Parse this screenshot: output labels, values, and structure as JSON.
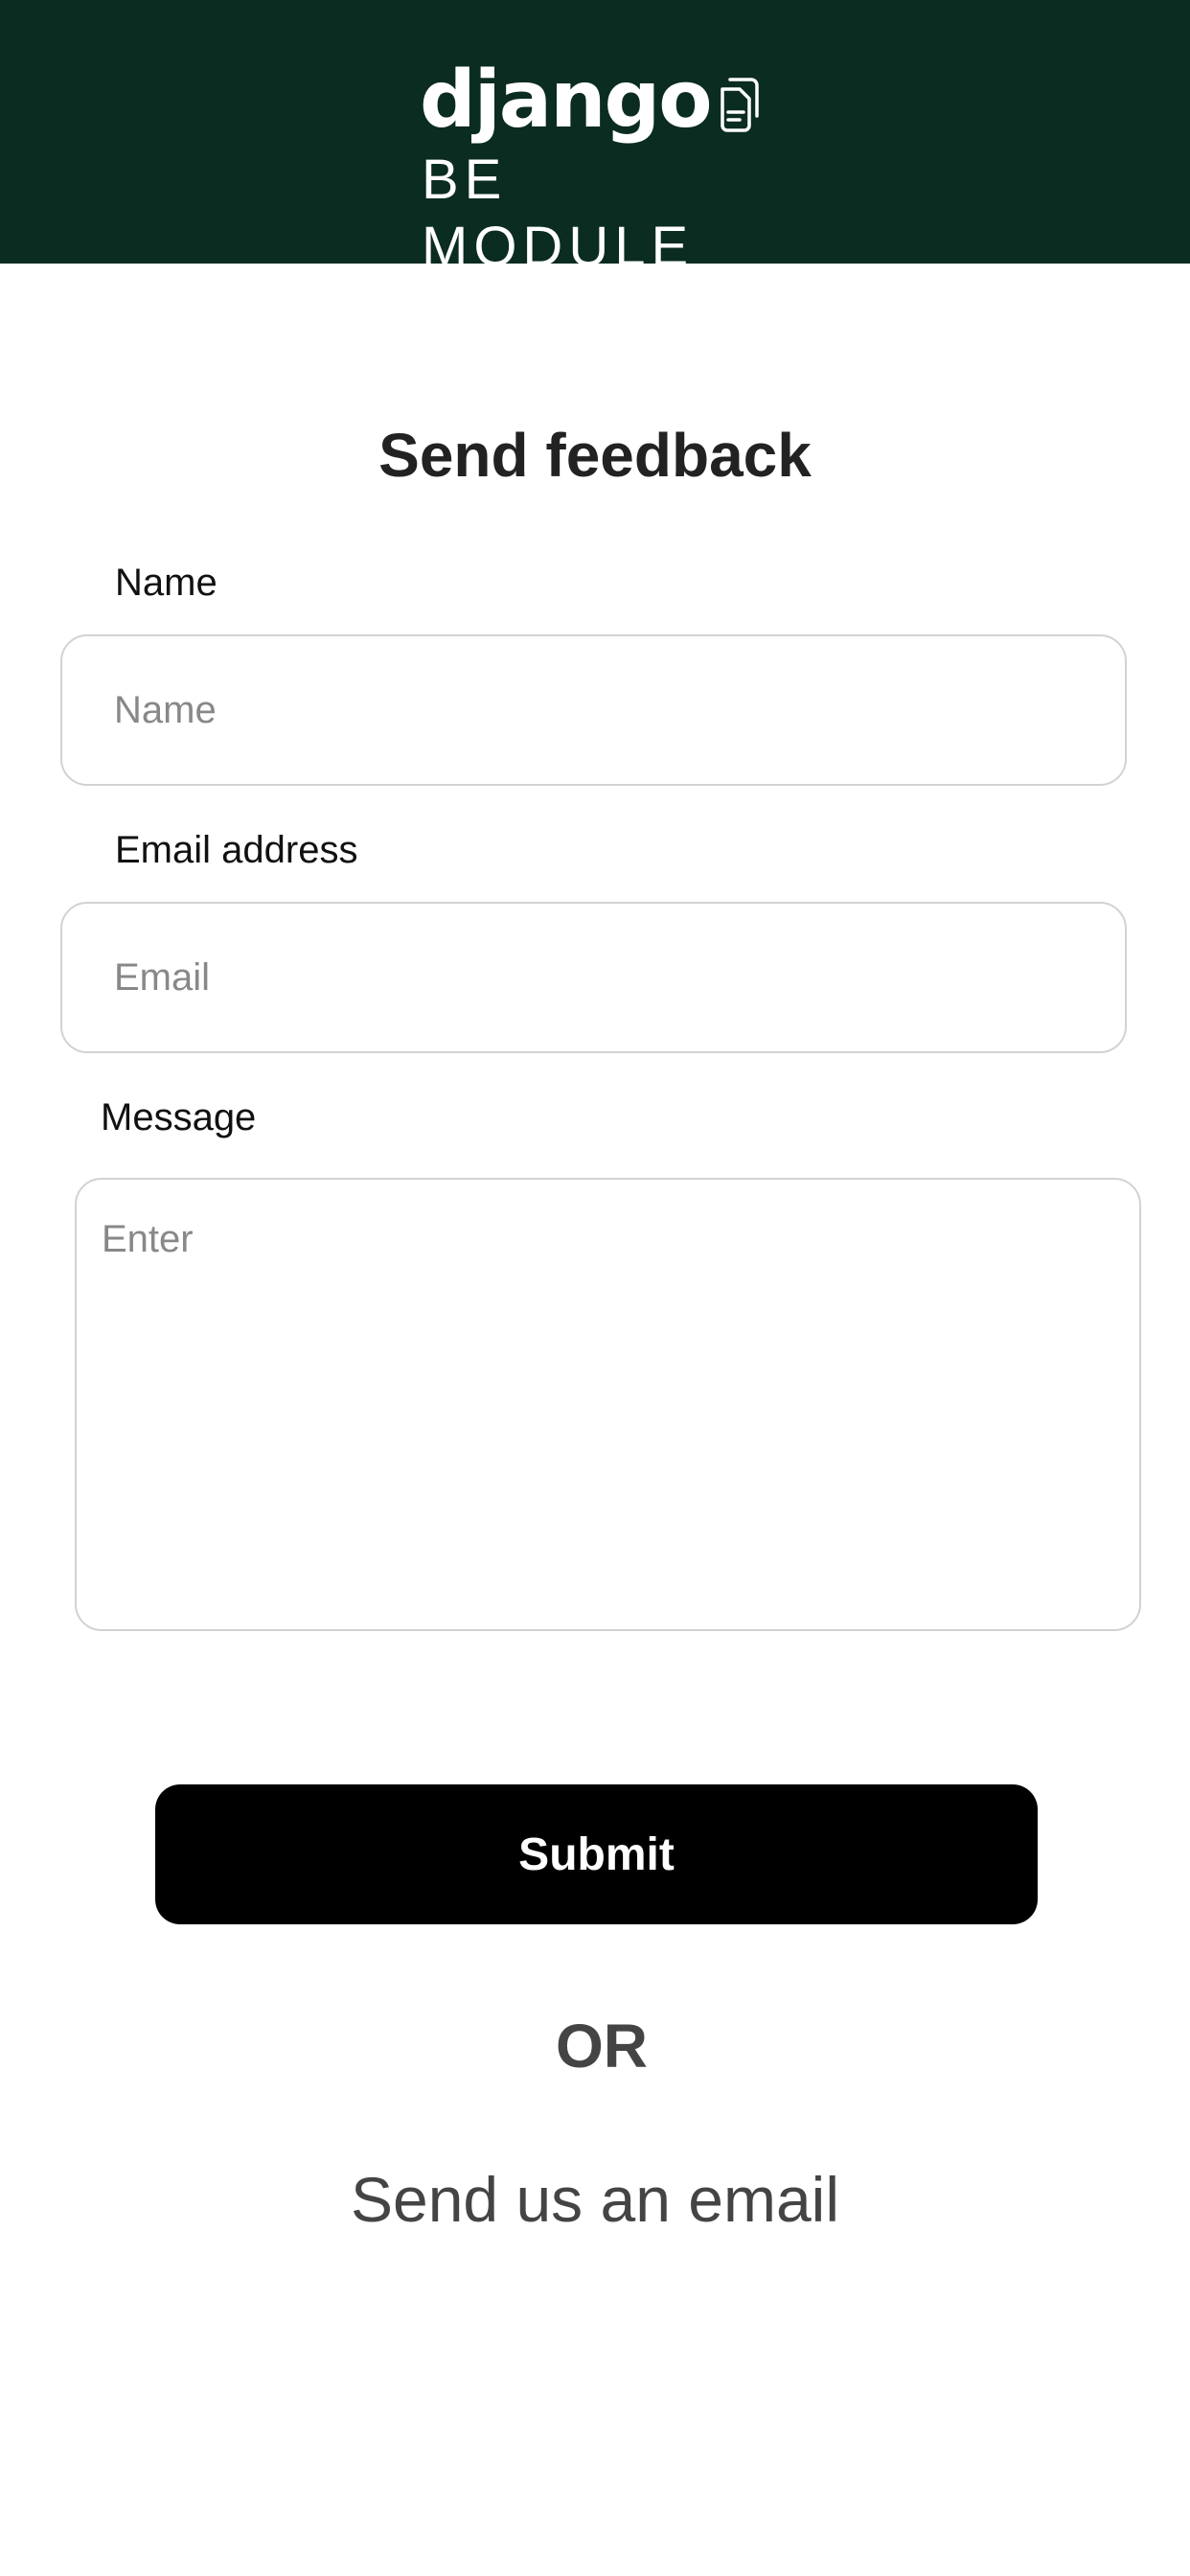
{
  "header": {
    "logo_word": "django",
    "logo_sub": "BE MODULE",
    "logo_icon": "document-icon",
    "background_color": "#0b2c20"
  },
  "page": {
    "title": "Send feedback"
  },
  "form": {
    "name": {
      "label": "Name",
      "placeholder": "Name",
      "value": ""
    },
    "email": {
      "label": "Email address",
      "placeholder": "Email",
      "value": ""
    },
    "message": {
      "label": "Message",
      "placeholder": "Enter",
      "value": ""
    },
    "submit_label": "Submit"
  },
  "footer": {
    "or_text": "OR",
    "email_link": "Send us an email"
  }
}
